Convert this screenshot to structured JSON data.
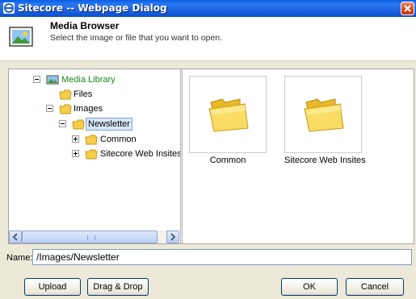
{
  "window": {
    "title": "Sitecore -- Webpage Dialog"
  },
  "header": {
    "title": "Media Browser",
    "subtitle": "Select the image or file that you want to open."
  },
  "tree": {
    "root": {
      "label": "Media Library",
      "color": "#1a8a1a"
    },
    "files": {
      "label": "Files"
    },
    "images": {
      "label": "Images"
    },
    "newsletter": {
      "label": "Newsletter"
    },
    "common": {
      "label": "Common"
    },
    "sitecore": {
      "label": "Sitecore Web Insites"
    }
  },
  "thumbnails": [
    {
      "label": "Common"
    },
    {
      "label": "Sitecore Web Insites"
    }
  ],
  "name_field": {
    "label": "Name:",
    "value": "/Images/Newsletter"
  },
  "buttons": {
    "upload": "Upload",
    "drag_drop": "Drag & Drop",
    "ok": "OK",
    "cancel": "Cancel"
  }
}
